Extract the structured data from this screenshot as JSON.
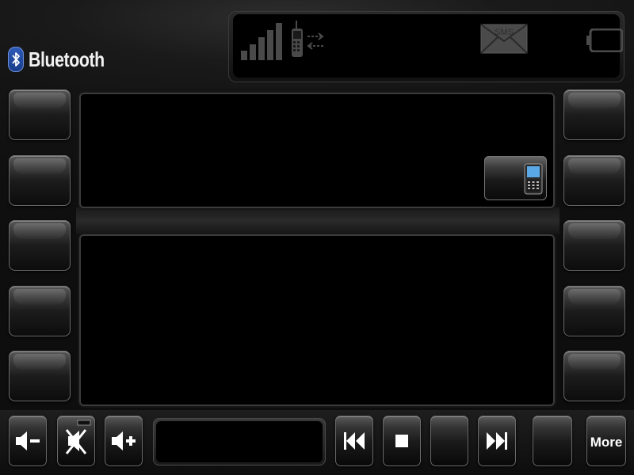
{
  "brand": {
    "name": "Bluetooth",
    "accent_color": "#2e5bb8"
  },
  "status_bar": {
    "signal_icon": "signal-bars-icon",
    "phone_icon": "phone-transfer-icon",
    "sms_icon": "sms-envelope-icon",
    "sms_label": "SMS",
    "battery_icon": "battery-icon"
  },
  "left_buttons": [
    {
      "label": ""
    },
    {
      "label": ""
    },
    {
      "label": ""
    },
    {
      "label": ""
    },
    {
      "label": ""
    }
  ],
  "right_buttons": [
    {
      "label": ""
    },
    {
      "label": ""
    },
    {
      "label": ""
    },
    {
      "label": ""
    },
    {
      "label": ""
    }
  ],
  "top_panel": {
    "text": "",
    "phone_button_icon": "mobile-phone-icon"
  },
  "bottom_panel": {
    "text": ""
  },
  "controls": {
    "volume_down_icon": "volume-down-icon",
    "mute_icon": "mute-icon",
    "volume_up_icon": "volume-up-icon",
    "display_text": "",
    "previous_icon": "previous-track-icon",
    "stop_icon": "stop-icon",
    "next_icon": "next-track-icon",
    "more_label": "More"
  }
}
